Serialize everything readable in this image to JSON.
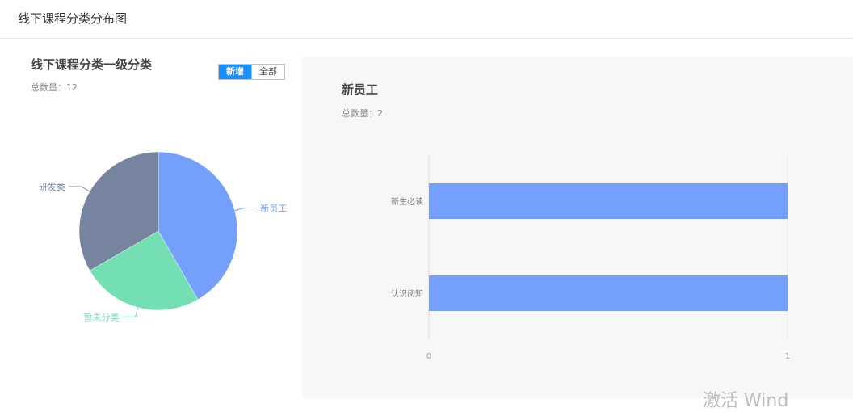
{
  "page": {
    "title": "线下课程分类分布图"
  },
  "left_panel": {
    "title": "线下课程分类一级分类",
    "total_label": "总数量：12",
    "toggle": [
      {
        "label": "新增",
        "active": true
      },
      {
        "label": "全部",
        "active": false
      }
    ]
  },
  "right_panel": {
    "title": "新员工",
    "total_label": "总数量：2"
  },
  "watermark": "激活 Wind",
  "chart_data": [
    {
      "type": "pie",
      "total": 12,
      "slices": [
        {
          "label": "新员工",
          "value": 5,
          "color": "#749ffb"
        },
        {
          "label": "暂未分类",
          "value": 3,
          "color": "#74dfb3"
        },
        {
          "label": "研发类",
          "value": 4,
          "color": "#76849f"
        }
      ]
    },
    {
      "type": "bar",
      "orientation": "horizontal",
      "categories": [
        "新生必读",
        "认识阅知"
      ],
      "values": [
        1,
        1
      ],
      "color": "#749ffb",
      "xlim": [
        0,
        1
      ],
      "xticks": [
        "0",
        "1"
      ]
    }
  ]
}
